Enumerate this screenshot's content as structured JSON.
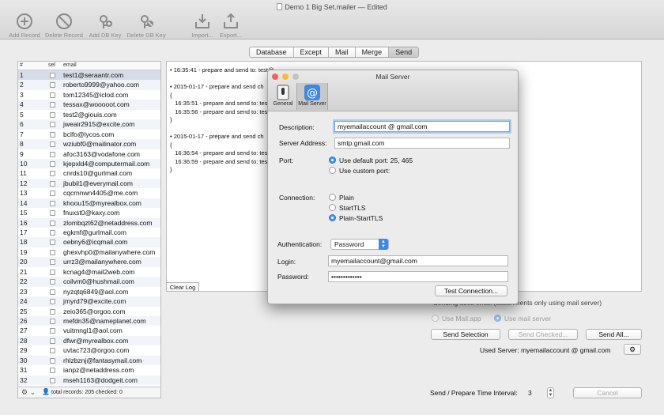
{
  "window": {
    "title": "Demo 1 Big Set.mailer",
    "edited": "— Edited"
  },
  "toolbar": [
    {
      "label": "Add Record",
      "icon": "plus-circle-icon"
    },
    {
      "label": "Delete Record",
      "icon": "no-circle-icon"
    },
    {
      "label": "Add DB Key",
      "icon": "add-key-icon"
    },
    {
      "label": "Delete DB Key",
      "icon": "delete-key-icon"
    },
    {
      "label": "Import...",
      "icon": "import-icon"
    },
    {
      "label": "Export...",
      "icon": "export-icon"
    }
  ],
  "tabs": [
    "Database",
    "Except",
    "Mail",
    "Merge",
    "Send"
  ],
  "active_tab": "Send",
  "table": {
    "headers": {
      "num": "#",
      "sel": "sel",
      "email": "email"
    },
    "rows": [
      {
        "n": "1",
        "email": "test1@seraantr.com"
      },
      {
        "n": "2",
        "email": "roberto9999@yahoo.com"
      },
      {
        "n": "3",
        "email": "tom12345@iclod.com"
      },
      {
        "n": "4",
        "email": "tessax@wooooot.com"
      },
      {
        "n": "5",
        "email": "test2@giouis.com"
      },
      {
        "n": "6",
        "email": "jweair2915@excite.com"
      },
      {
        "n": "7",
        "email": "bclfo@lycos.com"
      },
      {
        "n": "8",
        "email": "wziubf0@mailinator.com"
      },
      {
        "n": "9",
        "email": "afoc3163@vodafone.com"
      },
      {
        "n": "10",
        "email": "kjepxld4@computermail.com"
      },
      {
        "n": "11",
        "email": "cnrds10@gurlmail.com"
      },
      {
        "n": "12",
        "email": "jbubil1@everymail.com"
      },
      {
        "n": "13",
        "email": "cqcrnnwn4405@me.com"
      },
      {
        "n": "14",
        "email": "khoou15@myrealbox.com"
      },
      {
        "n": "15",
        "email": "fnuxst0@kaxy.com"
      },
      {
        "n": "16",
        "email": "zlombqzt62@netaddress.com"
      },
      {
        "n": "17",
        "email": "egkmf@gurlmail.com"
      },
      {
        "n": "18",
        "email": "oebny6@icqmail.com"
      },
      {
        "n": "19",
        "email": "ghexvhp0@mailanywhere.com"
      },
      {
        "n": "20",
        "email": "urrz3@mailanywhere.com"
      },
      {
        "n": "21",
        "email": "kcnag4@mail2web.com"
      },
      {
        "n": "22",
        "email": "coilvm0@hushmail.com"
      },
      {
        "n": "23",
        "email": "nyzqtq6849@aol.com"
      },
      {
        "n": "24",
        "email": "jmyrd79@excite.com"
      },
      {
        "n": "25",
        "email": "zeio365@orgoo.com"
      },
      {
        "n": "26",
        "email": "mefdn35@nameplanet.com"
      },
      {
        "n": "27",
        "email": "vuitmngl1@aol.com"
      },
      {
        "n": "28",
        "email": "dfwr@myrealbox.com"
      },
      {
        "n": "29",
        "email": "uvtac723@orgoo.com"
      },
      {
        "n": "30",
        "email": "rhlzbznj@fantasymail.com"
      },
      {
        "n": "31",
        "email": "ianpz@netaddress.com"
      },
      {
        "n": "32",
        "email": "mseh1163@dodgeit.com"
      }
    ],
    "footer": "total records: 205  checked: 0"
  },
  "log": {
    "lines": [
      "• 16:35:41 - prepare and send to: test@",
      "",
      "• 2015-01-17 - prepare and send ch",
      "{",
      "   16:35:51 - prepare and send to: test",
      "   16:35:56 - prepare and send to: test",
      "}",
      "",
      "• 2015-01-17 - prepare and send ch",
      "{",
      "   16:36:54 - prepare and send to: test",
      "   16:36:59 - prepare and send to: test",
      "}"
    ],
    "clear_label": "Clear Log"
  },
  "send": {
    "info": "Sending uses email (attachments only using mail server)",
    "use_mail_app": "Use Mail.app",
    "use_mail_server": "Use mail server",
    "send_selection": "Send Selection",
    "send_checked": "Send Checked...",
    "send_all": "Send All...",
    "used_server": "Used Server: myemailaccount @ gmail.com",
    "interval_label": "Send / Prepare Time Interval:",
    "interval_value": "3",
    "cancel": "Cancel"
  },
  "dialog": {
    "title": "Mail Server",
    "tabs": [
      {
        "label": "General",
        "icon": "general-switch-icon"
      },
      {
        "label": "Mail Server",
        "icon": "at-sign-icon"
      }
    ],
    "description_label": "Description:",
    "description_value": "myemailaccount @ gmail.com",
    "server_label": "Server Address:",
    "server_value": "smtp.gmail.com",
    "port_label": "Port:",
    "port_default": "Use default port: 25, 465",
    "port_custom": "Use custom port:",
    "connection_label": "Connection:",
    "conn_plain": "Plain",
    "conn_starttls": "StartTLS",
    "conn_plain_starttls": "Plain-StartTLS",
    "auth_label": "Authentication:",
    "auth_value": "Password",
    "login_label": "Login:",
    "login_value": "myemailaccount@gmail.com",
    "password_label": "Password:",
    "password_value": "•••••••••••••",
    "test_label": "Test Connection..."
  },
  "colors": {
    "accent": "#3b8ff6",
    "close": "#fc5f57",
    "min": "#fdbc2e",
    "zoom": "#c3c3c3"
  }
}
